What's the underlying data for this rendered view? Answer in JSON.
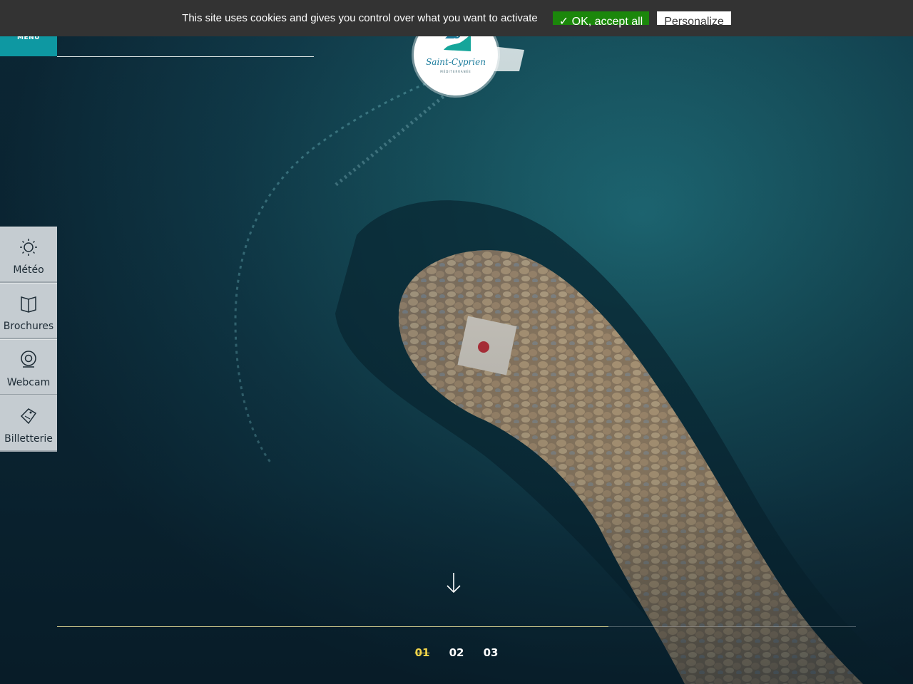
{
  "cookie_banner": {
    "message": "This site uses cookies and gives you control over what you want to activate",
    "accept_label": "✓ OK, accept all",
    "personalize_label": "Personalize"
  },
  "header": {
    "menu_label": "MENU",
    "logo_text": "Saint-Cyprien",
    "logo_subtext": "MÉDITERRANÉE"
  },
  "sidebar": {
    "items": [
      {
        "label": "Météo",
        "icon": "sun-icon"
      },
      {
        "label": "Brochures",
        "icon": "book-icon"
      },
      {
        "label": "Webcam",
        "icon": "webcam-icon"
      },
      {
        "label": "Billetterie",
        "icon": "ticket-icon"
      }
    ]
  },
  "slider": {
    "progress": 0.69,
    "pages": [
      "01",
      "02",
      "03"
    ],
    "active_page": "01"
  },
  "colors": {
    "menu_bg": "#0e98a2",
    "accept_bg": "#1b870b",
    "active_page": "#f1d44a",
    "sidebar_bg": "#c5ccd1"
  }
}
